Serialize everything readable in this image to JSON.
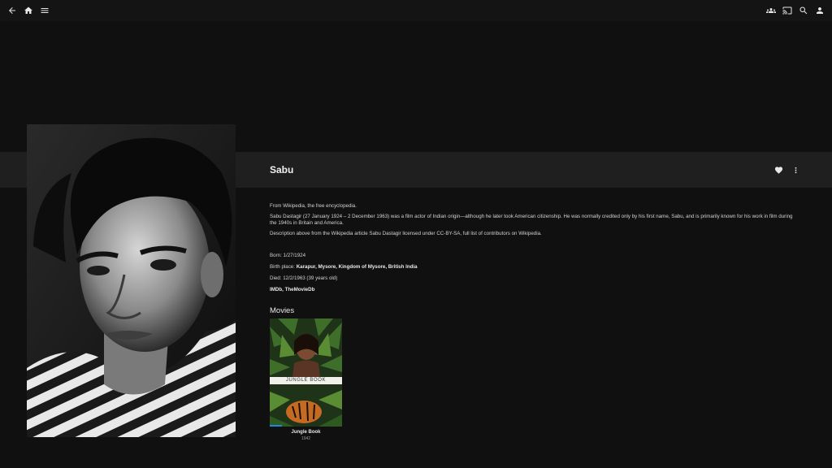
{
  "header": {
    "left_icons": [
      "arrow-back-icon",
      "home-icon",
      "menu-icon"
    ],
    "right_icons": [
      "group-icon",
      "cast-icon",
      "search-icon",
      "person-icon"
    ]
  },
  "person": {
    "name": "Sabu",
    "actions": [
      "heart-icon",
      "more-vert-icon"
    ]
  },
  "overview": {
    "paragraphs": [
      "From Wikipedia, the free encyclopedia.",
      "Sabu Dastagir (27 January 1924 – 2 December 1963) was a film actor of Indian origin—although he later took American citizenship. He was normally credited only by his first name, Sabu, and is primarily known for his work in film during the 1940s in Britain and America.",
      "Description above from the Wikipedia article Sabu Dastagir licensed under CC-BY-SA, full list of contributors on Wikipedia."
    ]
  },
  "details": {
    "born_label": "Born:",
    "born_value": "1/27/1924",
    "birthplace_label": "Birth place:",
    "birthplace_value": "Karapur, Mysore, Kingdom of Mysore, British India",
    "died_label": "Died:",
    "died_value": "12/2/1963 (39 years old)",
    "links": [
      "IMDb",
      "TheMovieDb"
    ]
  },
  "movies": {
    "heading": "Movies",
    "items": [
      {
        "title": "Jungle Book",
        "year": "1942",
        "poster_text": "JUNGLE BOOK",
        "progress": 0.17,
        "accent": "#1e88e5"
      }
    ]
  },
  "colors": {
    "background": "#101010",
    "header": "#141414",
    "title_band": "#1f1f1f",
    "progress": "#1e88e5"
  }
}
